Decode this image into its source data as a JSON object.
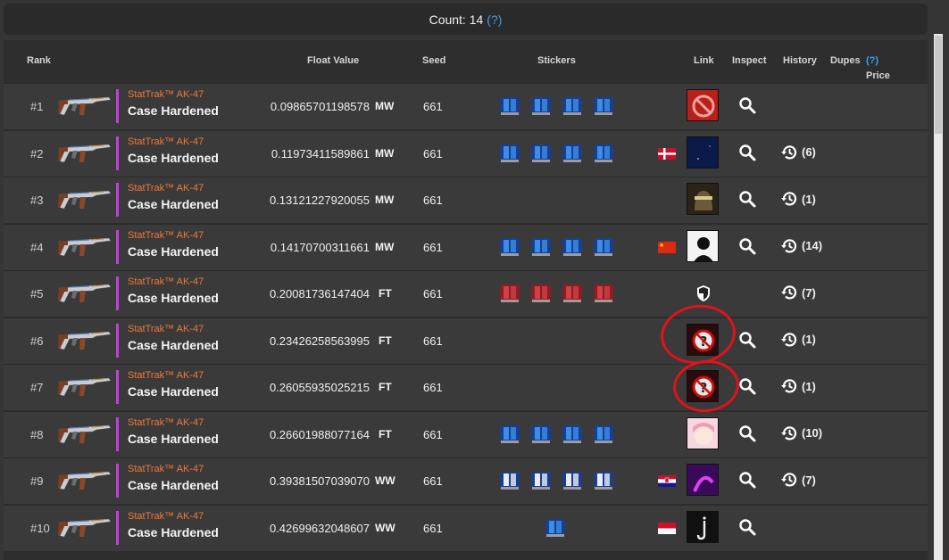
{
  "header": {
    "count_label": "Count: 14",
    "help": "(?)"
  },
  "columns": {
    "rank": "Rank",
    "float": "Float Value",
    "seed": "Seed",
    "stickers": "Stickers",
    "link": "Link",
    "inspect": "Inspect",
    "history": "History",
    "dupes": "Dupes",
    "price": "Price",
    "price_help": "(?)"
  },
  "colors": {
    "accent": "#3aa0f0",
    "stattrak": "#f07838",
    "rarity_bar": "#c040d8",
    "annotation": "#e0121a"
  },
  "rows": [
    {
      "rank": "#1",
      "stattrak": "StatTrak™ AK-47",
      "name": "Case Hardened",
      "float": "0.09865701198578",
      "wear": "MW",
      "seed": "661",
      "stickers": 4,
      "sticker_style": "blue",
      "flag": "",
      "avatar": "no-entry-avatar",
      "inspect": true,
      "history": ""
    },
    {
      "rank": "#2",
      "stattrak": "StatTrak™ AK-47",
      "name": "Case Hardened",
      "float": "0.11973411589861",
      "wear": "MW",
      "seed": "661",
      "stickers": 4,
      "sticker_style": "blue",
      "flag": "dk",
      "avatar": "space-avatar",
      "inspect": true,
      "history": "(6)"
    },
    {
      "rank": "#3",
      "stattrak": "StatTrak™ AK-47",
      "name": "Case Hardened",
      "float": "0.13121227920055",
      "wear": "MW",
      "seed": "661",
      "stickers": 0,
      "sticker_style": "",
      "flag": "",
      "avatar": "helmet-avatar",
      "inspect": true,
      "history": "(1)"
    },
    {
      "rank": "#4",
      "stattrak": "StatTrak™ AK-47",
      "name": "Case Hardened",
      "float": "0.14170700311661",
      "wear": "MW",
      "seed": "661",
      "stickers": 4,
      "sticker_style": "blue",
      "flag": "cn",
      "avatar": "silhouette-avatar",
      "inspect": true,
      "history": "(14)"
    },
    {
      "rank": "#5",
      "stattrak": "StatTrak™ AK-47",
      "name": "Case Hardened",
      "float": "0.20081736147404",
      "wear": "FT",
      "seed": "661",
      "stickers": 4,
      "sticker_style": "red",
      "flag": "",
      "avatar": "shield-icon",
      "inspect": false,
      "history": "(7)"
    },
    {
      "rank": "#6",
      "stattrak": "StatTrak™ AK-47",
      "name": "Case Hardened",
      "float": "0.23426258563995",
      "wear": "FT",
      "seed": "661",
      "stickers": 0,
      "sticker_style": "",
      "flag": "",
      "avatar": "unknown-avatar",
      "inspect": true,
      "history": "(1)"
    },
    {
      "rank": "#7",
      "stattrak": "StatTrak™ AK-47",
      "name": "Case Hardened",
      "float": "0.26055935025215",
      "wear": "FT",
      "seed": "661",
      "stickers": 0,
      "sticker_style": "",
      "flag": "",
      "avatar": "unknown-avatar",
      "inspect": true,
      "history": "(1)"
    },
    {
      "rank": "#8",
      "stattrak": "StatTrak™ AK-47",
      "name": "Case Hardened",
      "float": "0.26601988077164",
      "wear": "FT",
      "seed": "661",
      "stickers": 4,
      "sticker_style": "blue",
      "flag": "",
      "avatar": "anime-avatar",
      "inspect": true,
      "history": "(10)"
    },
    {
      "rank": "#9",
      "stattrak": "StatTrak™ AK-47",
      "name": "Case Hardened",
      "float": "0.39381507039070",
      "wear": "WW",
      "seed": "661",
      "stickers": 4,
      "sticker_style": "white",
      "flag": "hr",
      "avatar": "purple-avatar",
      "inspect": true,
      "history": "(7)"
    },
    {
      "rank": "#10",
      "stattrak": "StatTrak™ AK-47",
      "name": "Case Hardened",
      "float": "0.42699632048607",
      "wear": "WW",
      "seed": "661",
      "stickers": 1,
      "sticker_style": "blue",
      "flag": "id",
      "avatar": "hook-avatar",
      "inspect": true,
      "history": ""
    }
  ]
}
